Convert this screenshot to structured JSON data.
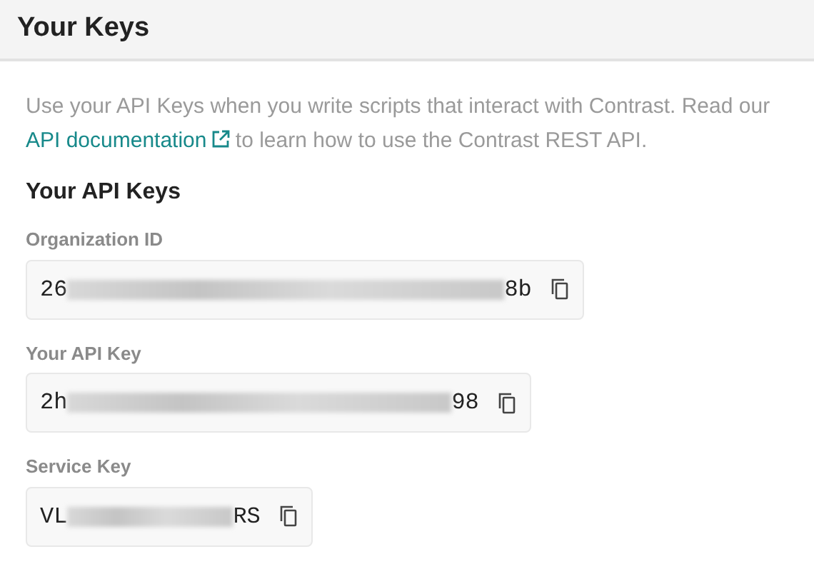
{
  "header": {
    "title": "Your Keys"
  },
  "intro": {
    "text_before": "Use your API Keys when you write scripts that interact with Contrast. Read our",
    "link": "API documentation",
    "text_after": "to learn how to use the Contrast REST API."
  },
  "section_title": "Your API Keys",
  "keys": [
    {
      "label": "Organization ID",
      "prefix": "26",
      "suffix": "8b",
      "redacted": true,
      "kind": "uuid"
    },
    {
      "label": "Your API Key",
      "prefix": "2h",
      "suffix": "98",
      "redacted": true,
      "kind": "token"
    },
    {
      "label": "Service Key",
      "prefix": "VL",
      "suffix": "RS",
      "redacted": true,
      "kind": "code"
    }
  ]
}
